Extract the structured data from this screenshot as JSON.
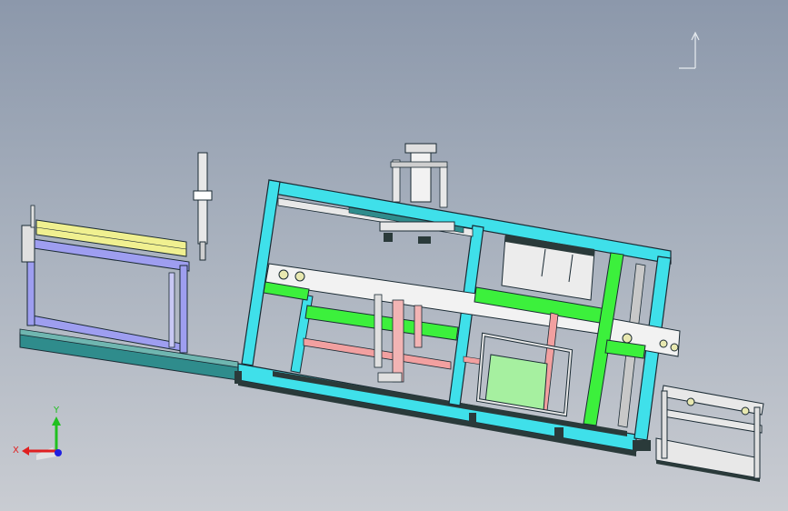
{
  "viewport": {
    "background_top": "#8c98ab",
    "background_bottom": "#c9ccd2"
  },
  "colors": {
    "frame_cyan": "#3fe0ea",
    "frame_outline": "#1a2a33",
    "beam_green": "#3cf03c",
    "rod_pink": "#f2a0a0",
    "panel_lightgreen": "#a6f0a0",
    "conveyor_blue": "#9e9ef0",
    "rail_yellow": "#f0f090",
    "base_teal": "#2f8c8c",
    "metal_gray": "#e0e0e0",
    "dark_steel": "#2a3a3a"
  },
  "triad": {
    "x_label": "X",
    "y_label": "Y",
    "x_color": "#e02020",
    "y_color": "#20c020",
    "z_color": "#2020e0"
  },
  "compass_icon": "view-orientation-icon"
}
